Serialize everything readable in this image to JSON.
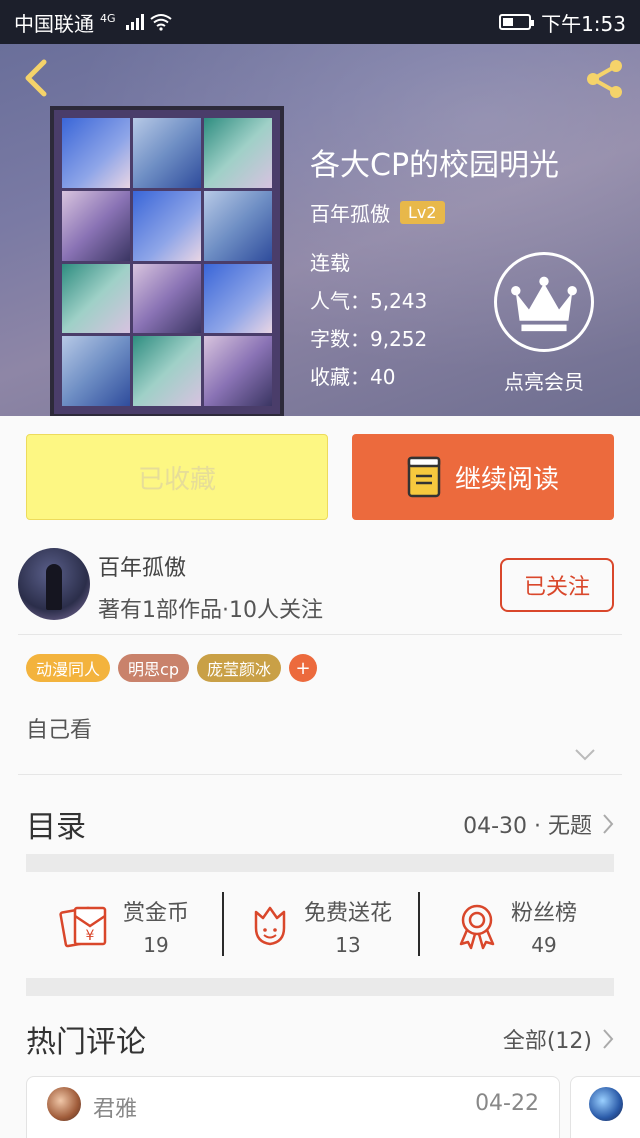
{
  "status_bar": {
    "carrier": "中国联通",
    "network": "4G",
    "time": "下午1:53"
  },
  "book": {
    "title": "各大CP的校园明光",
    "author": "百年孤傲",
    "level": "Lv2",
    "status": "连载",
    "popularity": "人气：5,243",
    "word_count": "字数：9,252",
    "favorites": "收藏：40",
    "vip_label": "点亮会员"
  },
  "actions": {
    "collected_label": "已收藏",
    "continue_label": "继续阅读"
  },
  "author_profile": {
    "name": "百年孤傲",
    "info": "著有1部作品·10人关注",
    "follow_label": "已关注"
  },
  "tags": [
    {
      "label": "动漫同人",
      "color": "#f3b33d"
    },
    {
      "label": "明思cp",
      "color": "#c9826b"
    },
    {
      "label": "庞莹颜冰",
      "color": "#c9a046"
    }
  ],
  "tag_add": "+",
  "description": "自己看",
  "catalog": {
    "heading": "目录",
    "latest": "04-30 · 无题"
  },
  "stats": [
    {
      "label": "赏金币",
      "value": "19",
      "icon": "reward-coin-icon"
    },
    {
      "label": "免费送花",
      "value": "13",
      "icon": "flower-icon"
    },
    {
      "label": "粉丝榜",
      "value": "49",
      "icon": "fan-rank-icon"
    }
  ],
  "comments": {
    "heading": "热门评论",
    "all_label": "全部(12)",
    "items": [
      {
        "name": "君雅",
        "date": "04-22"
      }
    ]
  },
  "colors": {
    "accent": "#ec6a3d",
    "follow": "#d9472b",
    "collected_bg": "#fdf783",
    "icon_red": "#d9472b"
  }
}
